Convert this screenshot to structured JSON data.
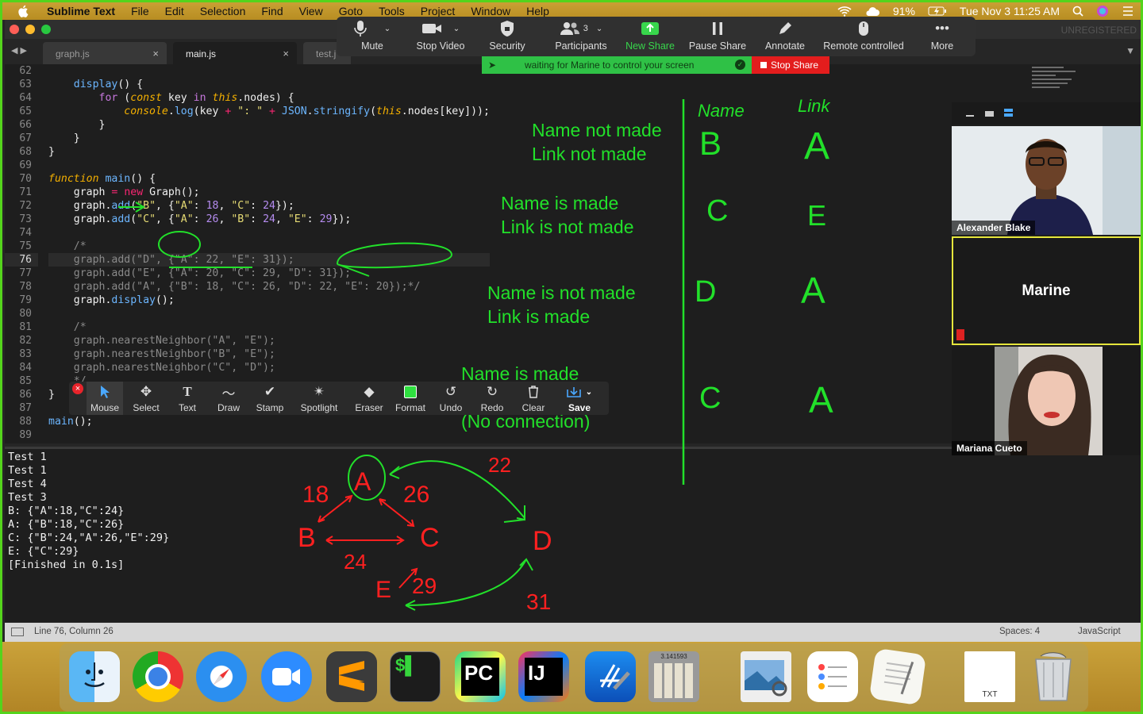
{
  "menubar": {
    "app_name": "Sublime Text",
    "items": [
      "File",
      "Edit",
      "Selection",
      "Find",
      "View",
      "Goto",
      "Tools",
      "Project",
      "Window",
      "Help"
    ],
    "battery": "91%",
    "datetime": "Tue Nov 3  11:25 AM"
  },
  "window": {
    "unregistered": "UNREGISTERED"
  },
  "tabs": [
    {
      "label": "graph.js",
      "close": "×"
    },
    {
      "label": "main.js",
      "close": "×"
    },
    {
      "label": "test.j"
    }
  ],
  "editor": {
    "line_numbers": [
      "62",
      "63",
      "64",
      "65",
      "66",
      "67",
      "68",
      "69",
      "70",
      "71",
      "72",
      "73",
      "74",
      "75",
      "76",
      "77",
      "78",
      "79",
      "80",
      "81",
      "82",
      "83",
      "84",
      "85",
      "86",
      "87",
      "88",
      "89"
    ],
    "current_line": "76",
    "comment_lines": [
      "75",
      "76",
      "77",
      "78",
      "81",
      "82",
      "83",
      "84"
    ],
    "code": {
      "l77": "    graph.add(\"E\", {\"A\": 20, \"C\": 29, \"D\": 31});",
      "l78": "    graph.add(\"A\", {\"B\": 18, \"C\": 26, \"D\": 22, \"E\": 20});*/",
      "l82": "    graph.nearestNeighbor(\"A\", \"E\");",
      "l83": "    graph.nearestNeighbor(\"B\", \"E\");",
      "l84": "    graph.nearestNeighbor(\"C\", \"D\");"
    }
  },
  "zoom_toolbar": {
    "items": [
      {
        "label": "Mute",
        "icon": "microphone-icon"
      },
      {
        "label": "Stop Video",
        "icon": "video-camera-icon"
      },
      {
        "label": "Security",
        "icon": "shield-icon"
      },
      {
        "label": "Participants",
        "icon": "participants-icon",
        "count": "3"
      },
      {
        "label": "New Share",
        "icon": "share-arrow-icon",
        "color": "#38d64c"
      },
      {
        "label": "Pause Share",
        "icon": "pause-icon"
      },
      {
        "label": "Annotate",
        "icon": "pencil-icon"
      },
      {
        "label": "Remote controlled",
        "icon": "mouse-icon"
      },
      {
        "label": "More",
        "icon": "more-dots-icon"
      }
    ],
    "waiting_text": "waiting for Marine to control your screen",
    "stop_share": "Stop Share"
  },
  "annotation_toolbar": {
    "items": [
      {
        "label": "Mouse",
        "icon": "cursor-arrow-icon"
      },
      {
        "label": "Select",
        "icon": "move-icon"
      },
      {
        "label": "Text",
        "icon": "text-icon"
      },
      {
        "label": "Draw",
        "icon": "squiggle-icon"
      },
      {
        "label": "Stamp",
        "icon": "checkmark-icon"
      },
      {
        "label": "Spotlight",
        "icon": "spotlight-icon"
      },
      {
        "label": "Eraser",
        "icon": "eraser-icon"
      },
      {
        "label": "Format",
        "icon": "format-square-icon"
      },
      {
        "label": "Undo",
        "icon": "undo-icon"
      },
      {
        "label": "Redo",
        "icon": "redo-icon"
      },
      {
        "label": "Clear",
        "icon": "trash-icon"
      },
      {
        "label": "Save",
        "icon": "save-icon"
      }
    ]
  },
  "console_lines": [
    "Test 1",
    "Test 1",
    "Test 4",
    "Test 3",
    "B: {\"A\":18,\"C\":24}",
    "A: {\"B\":18,\"C\":26}",
    "C: {\"B\":24,\"A\":26,\"E\":29}",
    "E: {\"C\":29}",
    "[Finished in 0.1s]"
  ],
  "annotations": {
    "notes": [
      {
        "line1": "Name not made",
        "line2": "Link not made"
      },
      {
        "line1": "Name is made",
        "line2": "Link is not made"
      },
      {
        "line1": "Name is not made",
        "line2": "Link is made"
      },
      {
        "line1": "Name is made",
        "line2": "(No connection)"
      }
    ],
    "table_headers": [
      "Name",
      "Link"
    ],
    "table_rows": [
      [
        "B",
        "A"
      ],
      [
        "C",
        "E"
      ],
      [
        "D",
        "A"
      ],
      [
        "C",
        "A"
      ]
    ],
    "graph_nodes": [
      "A",
      "B",
      "C",
      "D",
      "E"
    ],
    "graph_weights": [
      "18",
      "26",
      "24",
      "22",
      "29",
      "31"
    ],
    "colors": {
      "green": "#22e02a",
      "red": "#ff2020"
    }
  },
  "statusbar": {
    "position": "Line 76, Column 26",
    "spaces": "Spaces: 4",
    "syntax": "JavaScript"
  },
  "participants": [
    {
      "name": "Alexander Blake"
    },
    {
      "name": "Marine"
    },
    {
      "name": "Mariana Cueto"
    }
  ],
  "dock": {
    "apps": [
      "Finder",
      "Chrome",
      "Safari",
      "Zoom",
      "Sublime Text",
      "Terminal",
      "PyCharm",
      "IntelliJ IDEA",
      "Xcode",
      "Calculator",
      "Preview",
      "Reminders",
      "TextEdit",
      "TXT",
      "Trash"
    ],
    "calculator_display": "3.141593",
    "txt_label": "TXT"
  }
}
